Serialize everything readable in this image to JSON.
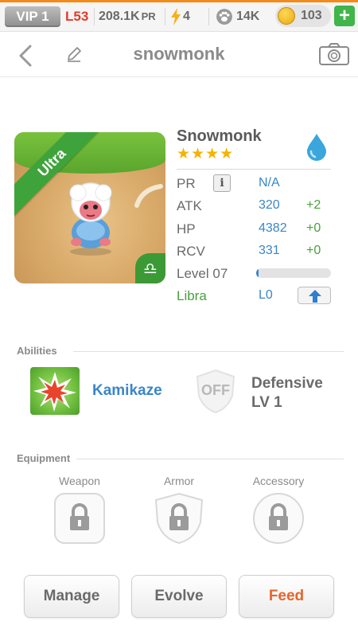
{
  "status_bar": {
    "vip": "VIP 1",
    "level": "L53",
    "pr_value": "208.1K",
    "pr_unit": "PR",
    "energy": "4",
    "paw_count": "14K",
    "coins": "103",
    "add_label": "+",
    "accent_orange": "#f28a1c",
    "add_color": "#3fb54a"
  },
  "header": {
    "title": "snowmonk",
    "icons": [
      "chevron-left-icon",
      "pencil-icon",
      "camera-icon"
    ]
  },
  "monster": {
    "name": "Snowmonk",
    "stars": "★★★★",
    "star_count": 4,
    "rarity": "Ultra",
    "element_icon": "water-drop-icon",
    "zodiac_symbol": "♎",
    "stats": [
      {
        "label": "PR",
        "value": "N/A",
        "bonus": ""
      },
      {
        "label": "ATK",
        "value": "320",
        "bonus": "+2"
      },
      {
        "label": "HP",
        "value": "4382",
        "bonus": "+0"
      },
      {
        "label": "RCV",
        "value": "331",
        "bonus": "+0"
      }
    ],
    "info_label": "i",
    "level_label": "Level 07",
    "level_progress": 0.03,
    "sign_label": "Libra",
    "sign_level": "L0"
  },
  "abilities": {
    "title": "Abilities",
    "items": [
      {
        "name": "Kamikaze",
        "icon": "explosion-icon"
      },
      {
        "name_line1": "Defensive",
        "name_line2": "LV 1",
        "icon_text": "OFF",
        "icon": "shield-off-icon"
      }
    ]
  },
  "equipment": {
    "title": "Equipment",
    "slots": [
      {
        "label": "Weapon",
        "icon": "lock-icon"
      },
      {
        "label": "Armor",
        "icon": "lock-icon"
      },
      {
        "label": "Accessory",
        "icon": "lock-icon"
      }
    ]
  },
  "actions": {
    "manage": "Manage",
    "evolve": "Evolve",
    "feed": "Feed"
  }
}
